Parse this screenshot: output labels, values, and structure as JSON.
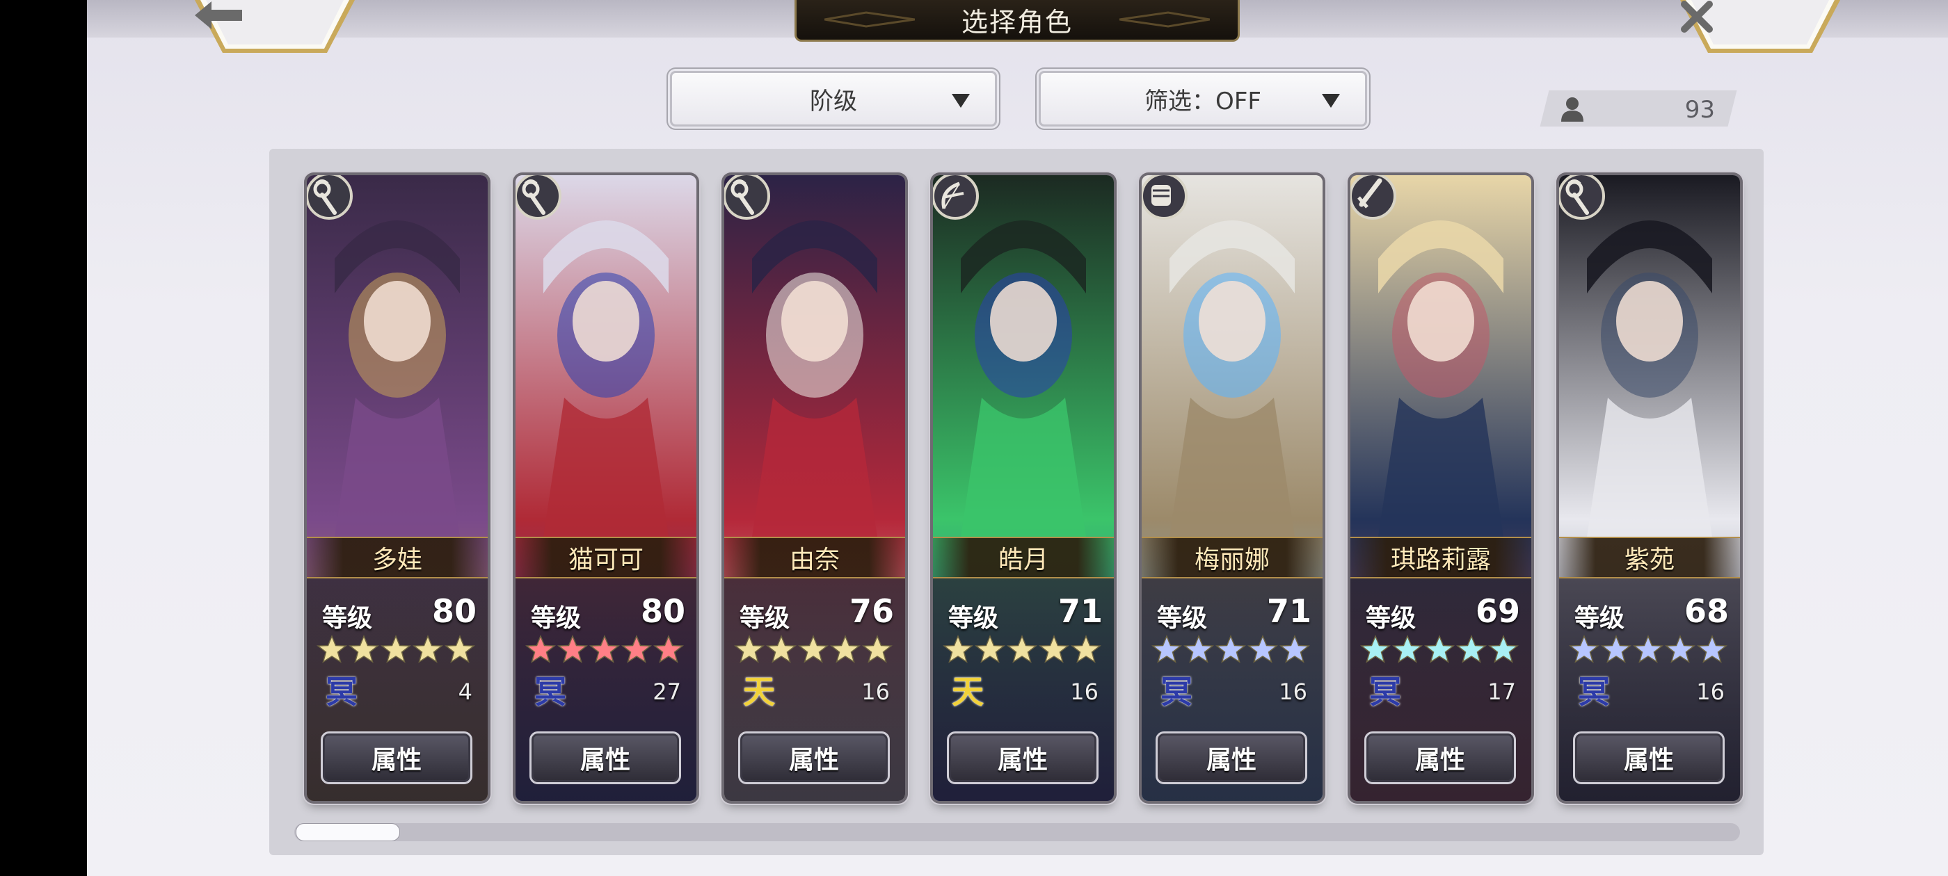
{
  "header": {
    "title": "选择角色",
    "back_icon": "back-arrow-icon",
    "close_icon": "close-icon"
  },
  "sort_dropdown": {
    "label": "阶级"
  },
  "filter_dropdown": {
    "label": "筛选：OFF"
  },
  "character_count": {
    "value": "93",
    "icon": "person-icon"
  },
  "level_label": "等级",
  "attribute_button_label": "属性",
  "characters": [
    {
      "name": "多娃",
      "level": "80",
      "stars": 5,
      "star_color": "#f0e1a0",
      "element": "冥",
      "element_color": "#2d3ba8",
      "count": "4",
      "class_icon": "staff-icon",
      "art_colors": [
        "#3a2a48",
        "#7a4a8a",
        "#c9a35a"
      ]
    },
    {
      "name": "猫可可",
      "level": "80",
      "stars": 5,
      "star_color": "#ff7f86",
      "element": "冥",
      "element_color": "#2d3ba8",
      "count": "27",
      "class_icon": "staff-icon",
      "art_colors": [
        "#dcd8e8",
        "#b02a36",
        "#2a3fb0"
      ]
    },
    {
      "name": "由奈",
      "level": "76",
      "stars": 5,
      "star_color": "#f0e1a0",
      "element": "天",
      "element_color": "#f2d23a",
      "count": "16",
      "class_icon": "staff-icon",
      "art_colors": [
        "#2c2346",
        "#b5283a",
        "#f2efe8"
      ]
    },
    {
      "name": "皓月",
      "level": "71",
      "stars": 5,
      "star_color": "#f0e1a0",
      "element": "天",
      "element_color": "#f2d23a",
      "count": "16",
      "class_icon": "bow-icon",
      "art_colors": [
        "#1c2a22",
        "#3bc46a",
        "#2a3fb0"
      ]
    },
    {
      "name": "梅丽娜",
      "level": "71",
      "stars": 5,
      "star_color": "#b7c6ff",
      "element": "冥",
      "element_color": "#2d3ba8",
      "count": "16",
      "class_icon": "gauntlet-icon",
      "art_colors": [
        "#e6e4e0",
        "#9c8a6a",
        "#5ab4ff"
      ]
    },
    {
      "name": "琪路莉露",
      "level": "69",
      "stars": 5,
      "star_color": "#a8f0f4",
      "element": "冥",
      "element_color": "#2d3ba8",
      "count": "17",
      "class_icon": "sword-icon",
      "art_colors": [
        "#e8d6a8",
        "#24345a",
        "#c05a6a"
      ]
    },
    {
      "name": "紫苑",
      "level": "68",
      "stars": 5,
      "star_color": "#b7c6ff",
      "element": "冥",
      "element_color": "#2d3ba8",
      "count": "16",
      "class_icon": "staff-icon",
      "art_colors": [
        "#1a1a22",
        "#e8e8ee",
        "#3a4a6a"
      ]
    }
  ],
  "scroll": {
    "position_fraction": 0.0
  }
}
